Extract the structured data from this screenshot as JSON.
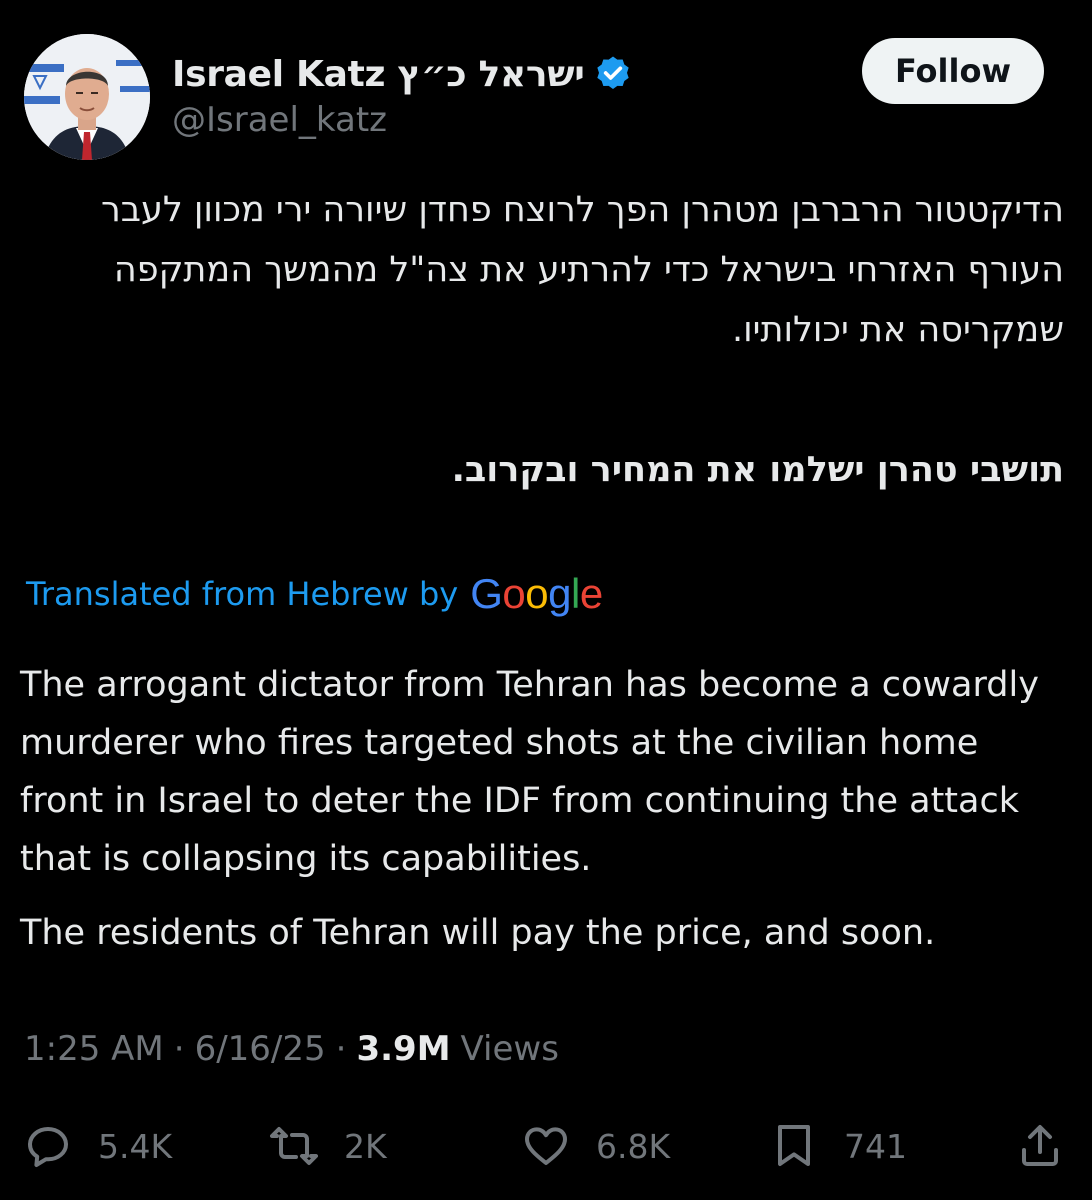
{
  "author": {
    "display_name": "Israel Katz ישראל כ״ץ",
    "handle": "@Israel_katz",
    "verified": true
  },
  "follow_button": {
    "label": "Follow"
  },
  "post": {
    "hebrew_text": "הדיקטטור הרברבן מטהרן הפך לרוצח פחדן שיורה ירי מכוון לעבר העורף האזרחי בישראל כדי להרתיע את צה\"ל מהמשך המתקפה שמקריסה את יכולותיו.",
    "hebrew_text_bold": "תושבי טהרן ישלמו את המחיר ובקרוב.",
    "translation_label": "Translated from Hebrew by",
    "translation_provider": "Google",
    "translation_paragraphs": [
      "The arrogant dictator from Tehran has become a cowardly murderer who fires targeted shots at the civilian home front in Israel to deter the IDF from continuing the attack that is collapsing its capabilities.",
      "The residents of Tehran will pay the price, and soon."
    ]
  },
  "meta": {
    "time": "1:25 AM",
    "date": "6/16/25",
    "views_count": "3.9M",
    "views_label": "Views"
  },
  "actions": {
    "replies": "5.4K",
    "reposts": "2K",
    "likes": "6.8K",
    "bookmarks": "741"
  },
  "colors": {
    "background": "#000000",
    "text": "#e7e9ea",
    "secondary": "#71767b",
    "link": "#1d9bf0",
    "verified": "#1d9bf0"
  }
}
